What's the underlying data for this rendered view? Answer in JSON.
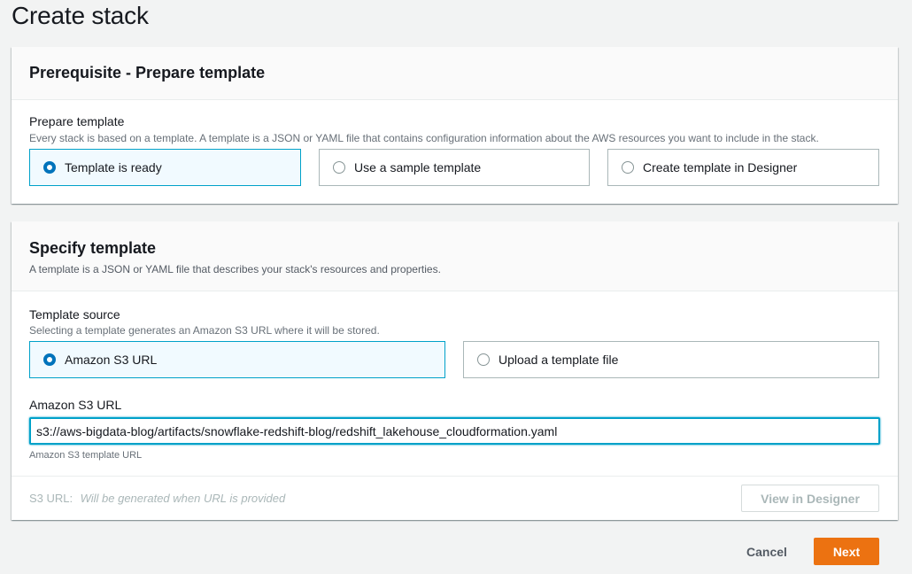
{
  "page": {
    "title": "Create stack"
  },
  "prerequisite": {
    "title": "Prerequisite - Prepare template",
    "field_label": "Prepare template",
    "field_desc": "Every stack is based on a template. A template is a JSON or YAML file that contains configuration information about the AWS resources you want to include in the stack.",
    "options": [
      {
        "label": "Template is ready",
        "selected": true
      },
      {
        "label": "Use a sample template",
        "selected": false
      },
      {
        "label": "Create template in Designer",
        "selected": false
      }
    ]
  },
  "specify": {
    "title": "Specify template",
    "desc": "A template is a JSON or YAML file that describes your stack's resources and properties.",
    "source_label": "Template source",
    "source_desc": "Selecting a template generates an Amazon S3 URL where it will be stored.",
    "options": [
      {
        "label": "Amazon S3 URL",
        "selected": true
      },
      {
        "label": "Upload a template file",
        "selected": false
      }
    ],
    "url_label": "Amazon S3 URL",
    "url_value": "s3://aws-bigdata-blog/artifacts/snowflake-redshift-blog/redshift_lakehouse_cloudformation.yaml",
    "url_hint": "Amazon S3 template URL",
    "s3_url_label": "S3 URL:",
    "s3_url_value": "Will be generated when URL is provided",
    "view_designer_label": "View in Designer"
  },
  "actions": {
    "cancel_label": "Cancel",
    "next_label": "Next"
  },
  "colors": {
    "accent": "#0073bb",
    "selected_border": "#00a1c9",
    "primary_button": "#ec7211"
  }
}
